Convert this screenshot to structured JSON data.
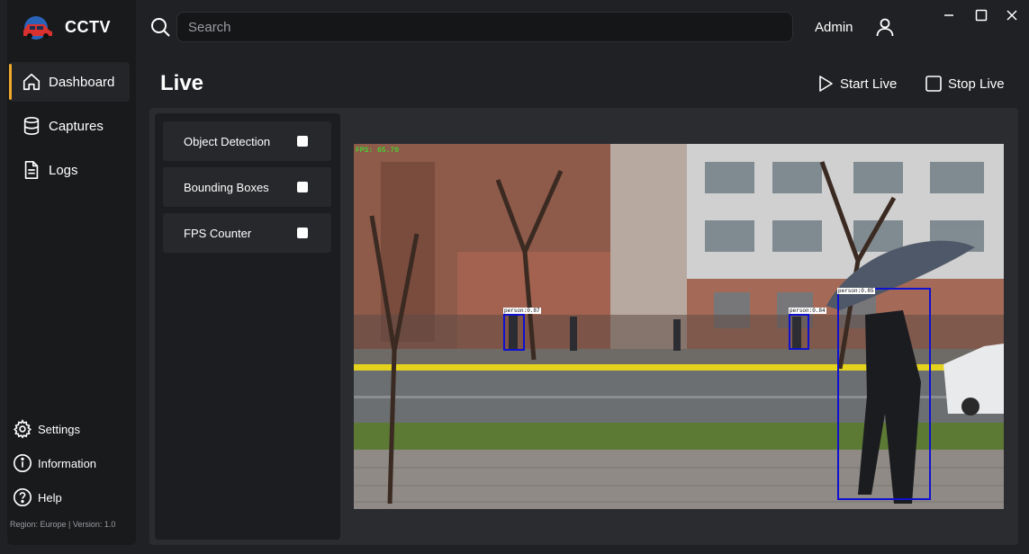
{
  "app": {
    "brand_name": "CCTV",
    "logo_icon": "car-logo-icon"
  },
  "sidebar": {
    "items": [
      {
        "label": "Dashboard",
        "icon": "home-icon",
        "active": true
      },
      {
        "label": "Captures",
        "icon": "database-icon",
        "active": false
      },
      {
        "label": "Logs",
        "icon": "document-icon",
        "active": false
      }
    ],
    "bottom_items": [
      {
        "label": "Settings",
        "icon": "gear-icon"
      },
      {
        "label": "Information",
        "icon": "info-icon"
      },
      {
        "label": "Help",
        "icon": "help-icon"
      }
    ],
    "footer": "Region: Europe | Version: 1.0"
  },
  "topbar": {
    "search_placeholder": "Search",
    "user_name": "Admin"
  },
  "page": {
    "title": "Live",
    "start_label": "Start Live",
    "stop_label": "Stop Live"
  },
  "options": [
    {
      "label": "Object Detection",
      "checked": false
    },
    {
      "label": "Bounding Boxes",
      "checked": false
    },
    {
      "label": "FPS Counter",
      "checked": false
    }
  ],
  "video": {
    "fps_text": "FPS: 65.70",
    "detections": [
      {
        "label": "person:0.87"
      },
      {
        "label": "person:0.84"
      },
      {
        "label": "person:0.85"
      }
    ]
  },
  "colors": {
    "accent": "#f0a92a",
    "background": "#202124",
    "sidebar": "#191a1c",
    "detection_box": "#1010d0",
    "fps_text": "#2bff2b"
  }
}
